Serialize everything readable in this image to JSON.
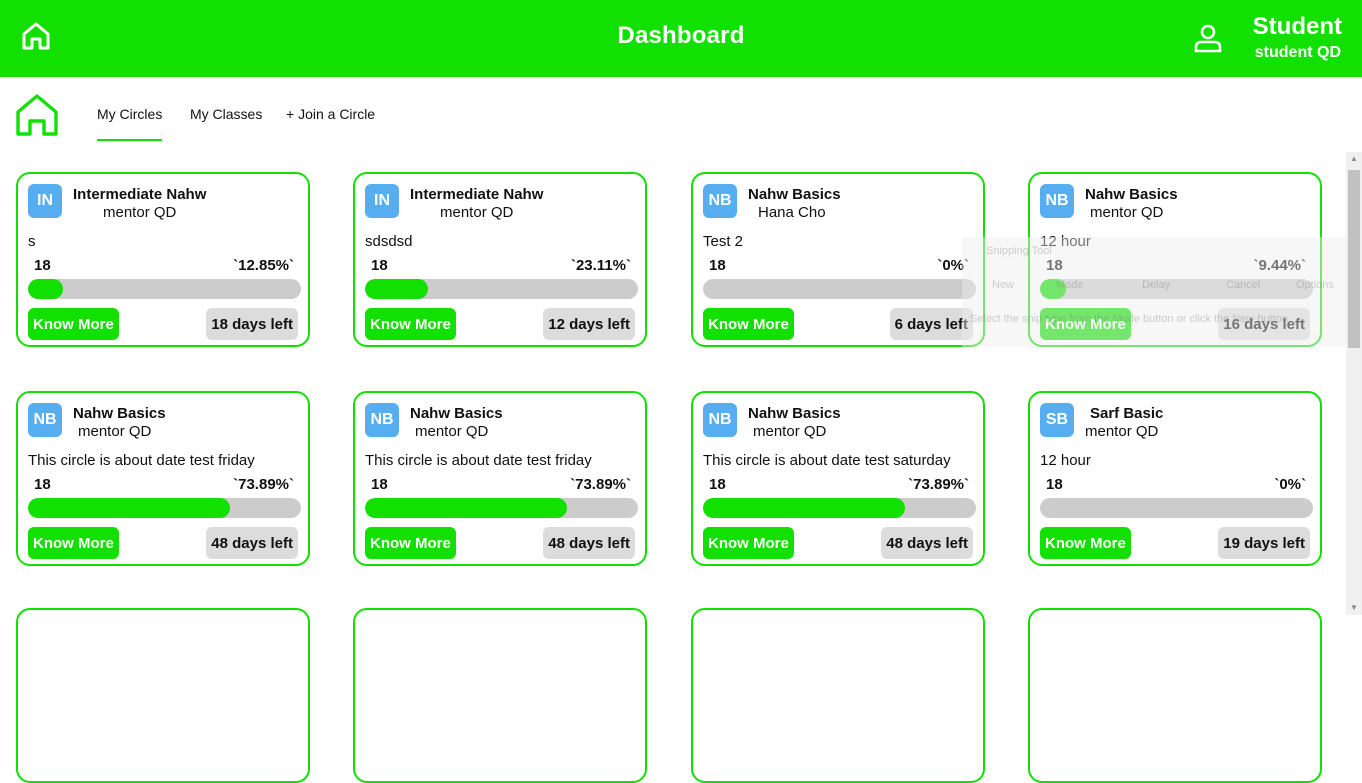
{
  "header": {
    "title": "Dashboard",
    "user_name": "Student",
    "user_subtitle": "student QD",
    "home_icon": "home-icon",
    "user_icon": "user-icon",
    "accent_color": "#11e000"
  },
  "tabs": [
    {
      "label": "My Circles",
      "active": true
    },
    {
      "label": "My Classes",
      "active": false
    },
    {
      "label": "+ Join a Circle",
      "active": false
    }
  ],
  "cards": [
    {
      "initials": "IN",
      "title": "Intermediate Nahw",
      "mentor": "mentor QD",
      "description": "s",
      "count": "18",
      "percent_label": "`12.85%`",
      "progress": 12.85,
      "button": "Know More",
      "days": "18 days left"
    },
    {
      "initials": "IN",
      "title": "Intermediate Nahw",
      "mentor": "mentor QD",
      "description": "sdsdsd",
      "count": "18",
      "percent_label": "`23.11%`",
      "progress": 23.11,
      "button": "Know More",
      "days": "12 days left"
    },
    {
      "initials": "NB",
      "title": "Nahw Basics",
      "mentor": "Hana Cho",
      "description": "Test 2",
      "count": "18",
      "percent_label": "`0%`",
      "progress": 0,
      "button": "Know More",
      "days": "6 days left"
    },
    {
      "initials": "NB",
      "title": "Nahw Basics",
      "mentor": "mentor QD",
      "description": "12 hour",
      "count": "18",
      "percent_label": "`9.44%`",
      "progress": 9.44,
      "button": "Know More",
      "days": "16 days left"
    },
    {
      "initials": "NB",
      "title": "Nahw Basics",
      "mentor": "mentor QD",
      "description": "This circle is about date test friday",
      "count": "18",
      "percent_label": "`73.89%`",
      "progress": 73.89,
      "button": "Know More",
      "days": "48 days left"
    },
    {
      "initials": "NB",
      "title": "Nahw Basics",
      "mentor": "mentor QD",
      "description": "This circle is about date test friday",
      "count": "18",
      "percent_label": "`73.89%`",
      "progress": 73.89,
      "button": "Know More",
      "days": "48 days left"
    },
    {
      "initials": "NB",
      "title": "Nahw Basics",
      "mentor": "mentor QD",
      "description": "This circle is about date test saturday",
      "count": "18",
      "percent_label": "`73.89%`",
      "progress": 73.89,
      "button": "Know More",
      "days": "48 days left"
    },
    {
      "initials": "SB",
      "title": "Sarf Basic",
      "mentor": "mentor QD",
      "description": "12 hour",
      "count": "18",
      "percent_label": "`0%`",
      "progress": 0,
      "button": "Know More",
      "days": "19 days left"
    }
  ],
  "overlay": {
    "title": "Snipping Tool",
    "new": "New",
    "mode": "Mode",
    "delay": "Delay",
    "cancel": "Cancel",
    "options": "Options",
    "hint": "Select the snip type from the Mode button or click the New button."
  }
}
